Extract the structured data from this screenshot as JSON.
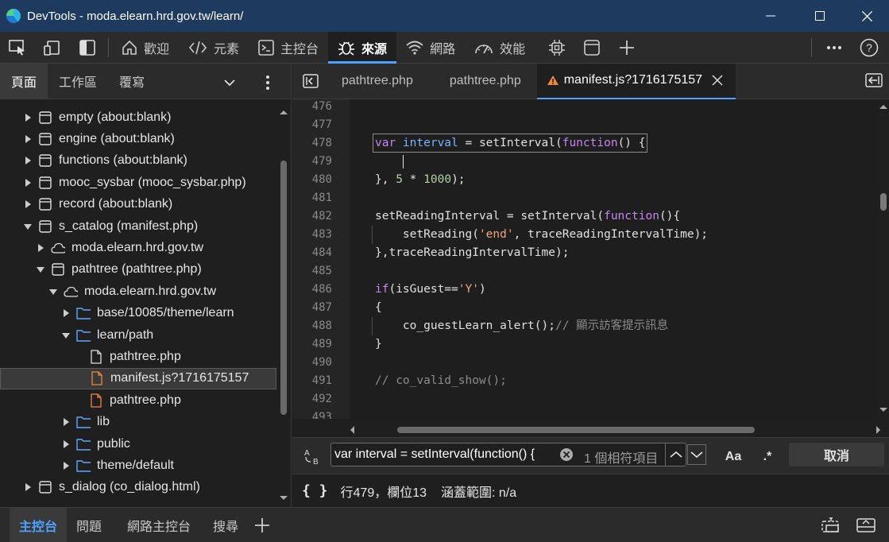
{
  "window": {
    "title": "DevTools - moda.elearn.hrd.gov.tw/learn/"
  },
  "toolbar": {
    "tabs": [
      {
        "label": "歡迎",
        "icon": "home-icon"
      },
      {
        "label": "元素",
        "icon": "code-tag-icon"
      },
      {
        "label": "主控台",
        "icon": "console-icon"
      },
      {
        "label": "來源",
        "icon": "bug-icon"
      },
      {
        "label": "網路",
        "icon": "wifi-icon"
      },
      {
        "label": "效能",
        "icon": "gauge-icon"
      }
    ]
  },
  "left_panel": {
    "tabs": [
      "頁面",
      "工作區",
      "覆寫"
    ],
    "tree": [
      {
        "label": "empty (about:blank)",
        "type": "frame",
        "expanded": false,
        "depth": 0
      },
      {
        "label": "engine (about:blank)",
        "type": "frame",
        "expanded": false,
        "depth": 0
      },
      {
        "label": "functions (about:blank)",
        "type": "frame",
        "expanded": false,
        "depth": 0
      },
      {
        "label": "mooc_sysbar (mooc_sysbar.php)",
        "type": "frame",
        "expanded": false,
        "depth": 0
      },
      {
        "label": "record (about:blank)",
        "type": "frame",
        "expanded": false,
        "depth": 0
      },
      {
        "label": "s_catalog (manifest.php)",
        "type": "frame",
        "expanded": true,
        "depth": 0
      },
      {
        "label": "moda.elearn.hrd.gov.tw",
        "type": "cloud",
        "expanded": false,
        "depth": 1
      },
      {
        "label": "pathtree (pathtree.php)",
        "type": "frame",
        "expanded": true,
        "depth": 1
      },
      {
        "label": "moda.elearn.hrd.gov.tw",
        "type": "cloud",
        "expanded": true,
        "depth": 2
      },
      {
        "label": "base/10085/theme/learn",
        "type": "folder",
        "expanded": false,
        "depth": 3
      },
      {
        "label": "learn/path",
        "type": "folder",
        "expanded": true,
        "depth": 3
      },
      {
        "label": "pathtree.php",
        "type": "file",
        "depth": 4
      },
      {
        "label": "manifest.js?1716175157",
        "type": "file-js",
        "depth": 4,
        "selected": true
      },
      {
        "label": "pathtree.php",
        "type": "file-js",
        "depth": 4
      },
      {
        "label": "lib",
        "type": "folder",
        "expanded": false,
        "depth": 3
      },
      {
        "label": "public",
        "type": "folder",
        "expanded": false,
        "depth": 3
      },
      {
        "label": "theme/default",
        "type": "folder",
        "expanded": false,
        "depth": 3
      },
      {
        "label": "s_dialog (co_dialog.html)",
        "type": "frame",
        "expanded": false,
        "depth": 0
      }
    ]
  },
  "editor": {
    "tabs": [
      {
        "label": "pathtree.php",
        "active": false,
        "warning": false
      },
      {
        "label": "pathtree.php",
        "active": false,
        "warning": false
      },
      {
        "label": "manifest.js?1716175157",
        "active": true,
        "warning": true
      }
    ],
    "lines": [
      {
        "n": "476",
        "tokens": []
      },
      {
        "n": "477",
        "tokens": []
      },
      {
        "n": "478",
        "tokens": [
          [
            "kw",
            "var "
          ],
          [
            "var",
            "interval"
          ],
          [
            "fn",
            " = setInterval("
          ],
          [
            "kw",
            "function"
          ],
          [
            "fn",
            "() {"
          ]
        ],
        "highlight": true
      },
      {
        "n": "479",
        "tokens": []
      },
      {
        "n": "480",
        "tokens": [
          [
            "fn",
            "}, "
          ],
          [
            "num",
            "5"
          ],
          [
            "fn",
            " * "
          ],
          [
            "num",
            "1000"
          ],
          [
            "fn",
            ");"
          ]
        ]
      },
      {
        "n": "481",
        "tokens": []
      },
      {
        "n": "482",
        "tokens": [
          [
            "fn",
            "setReadingInterval = setInterval("
          ],
          [
            "kw",
            "function"
          ],
          [
            "fn",
            "(){"
          ]
        ]
      },
      {
        "n": "483",
        "tokens": [
          [
            "fn",
            "    setReading("
          ],
          [
            "str",
            "'end'"
          ],
          [
            "fn",
            ", traceReadingIntervalTime);"
          ]
        ]
      },
      {
        "n": "484",
        "tokens": [
          [
            "fn",
            "},traceReadingIntervalTime);"
          ]
        ]
      },
      {
        "n": "485",
        "tokens": []
      },
      {
        "n": "486",
        "tokens": [
          [
            "kw",
            "if"
          ],
          [
            "fn",
            "(isGuest=="
          ],
          [
            "str",
            "'Y'"
          ],
          [
            "fn",
            ")"
          ]
        ]
      },
      {
        "n": "487",
        "tokens": [
          [
            "fn",
            "{"
          ]
        ]
      },
      {
        "n": "488",
        "tokens": [
          [
            "fn",
            "    co_guestLearn_alert();"
          ],
          [
            "cm",
            "// 顯示訪客提示訊息"
          ]
        ]
      },
      {
        "n": "489",
        "tokens": [
          [
            "fn",
            "}"
          ]
        ]
      },
      {
        "n": "490",
        "tokens": []
      },
      {
        "n": "491",
        "tokens": [
          [
            "cm",
            "// co_valid_show();"
          ]
        ]
      },
      {
        "n": "492",
        "tokens": []
      },
      {
        "n": "493",
        "tokens": []
      }
    ]
  },
  "search": {
    "value": "var interval = setInterval(function() {",
    "match_count": "1 個相符項目",
    "case_label": "Aa",
    "regex_label": ".*",
    "cancel_label": "取消"
  },
  "status": {
    "braces": "{ }",
    "position": "行479，欄位13",
    "coverage": "涵蓋範圍: n/a"
  },
  "drawer": {
    "tabs": [
      "主控台",
      "問題",
      "網路主控台",
      "搜尋"
    ]
  },
  "colors": {
    "titlebar": "#1e3a5f",
    "accent": "#4ea1ff",
    "keyword": "#c586f0",
    "string": "#f4a37c",
    "warning": "#f0883e"
  }
}
